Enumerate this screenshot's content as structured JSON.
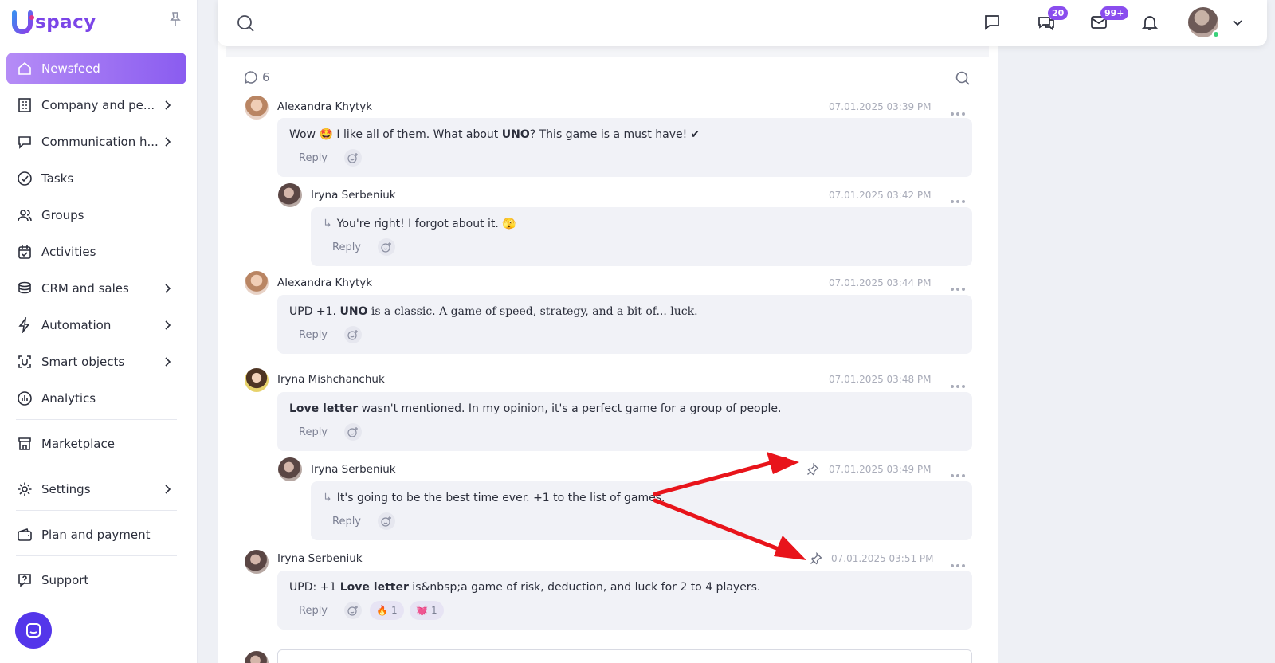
{
  "app": {
    "logo_text": "spacy"
  },
  "sidebar": {
    "items": [
      {
        "label": "Newsfeed",
        "active": true,
        "icon": "home-icon"
      },
      {
        "label": "Company and pe...",
        "chevron": true,
        "icon": "building-icon"
      },
      {
        "label": "Communication h...",
        "chevron": true,
        "icon": "communication-icon"
      },
      {
        "label": "Tasks",
        "icon": "check-circle-icon"
      },
      {
        "label": "Groups",
        "icon": "users-icon"
      },
      {
        "label": "Activities",
        "icon": "calendar-icon"
      },
      {
        "label": "CRM and sales",
        "chevron": true,
        "icon": "coins-icon"
      },
      {
        "label": "Automation",
        "chevron": true,
        "icon": "lightning-icon"
      },
      {
        "label": "Smart objects",
        "chevron": true,
        "icon": "smart-object-icon"
      },
      {
        "label": "Analytics",
        "icon": "chart-icon"
      },
      {
        "label": "Marketplace",
        "icon": "store-icon"
      },
      {
        "label": "Settings",
        "chevron": true,
        "icon": "gear-icon"
      },
      {
        "label": "Plan and payment",
        "icon": "wallet-icon"
      },
      {
        "label": "Support",
        "icon": "help-icon"
      }
    ]
  },
  "topbar": {
    "chat_badge": "20",
    "mail_badge": "99+"
  },
  "comments": {
    "count": "6",
    "list": [
      {
        "author": "Alexandra Khytyk",
        "time": "07.01.2025 03:39 PM",
        "pre": "Wow 🤩 I like all of them. What about ",
        "bold": "UNO",
        "post": "? This game is a must have! ✔",
        "reply_label": "Reply"
      },
      {
        "author": "Iryna Serbeniuk",
        "time": "07.01.2025 03:42 PM",
        "text": "You're right! I forgot about it. 🫣",
        "reply_label": "Reply"
      },
      {
        "author": "Alexandra Khytyk",
        "time": "07.01.2025 03:44 PM",
        "pre": "UPD +1. ",
        "bold": "UNO",
        "post": " is a classic. A game of speed, strategy, and a bit of... luck.",
        "reply_label": "Reply"
      },
      {
        "author": "Iryna Mishchanchuk",
        "time": "07.01.2025 03:48 PM",
        "bold": "Love letter",
        "post": " wasn't mentioned. In my opinion, it's a perfect game for a group of people.",
        "reply_label": "Reply"
      },
      {
        "author": "Iryna Serbeniuk",
        "time": "07.01.2025 03:49 PM",
        "text": "It's going to be the best time ever. +1 to the list of games.",
        "reply_label": "Reply"
      },
      {
        "author": "Iryna Serbeniuk",
        "time": "07.01.2025 03:51 PM",
        "pre": "UPD: +1 ",
        "bold": "Love letter",
        "post": " is&nbsp;a game of risk, deduction, and luck for 2 to 4 players.",
        "reply_label": "Reply",
        "reactions": [
          {
            "emoji": "🔥",
            "count": "1"
          },
          {
            "emoji": "💓",
            "count": "1"
          }
        ]
      }
    ]
  },
  "colors": {
    "accent": "#8a5cf0",
    "annotation_arrow": "#e8141b"
  }
}
